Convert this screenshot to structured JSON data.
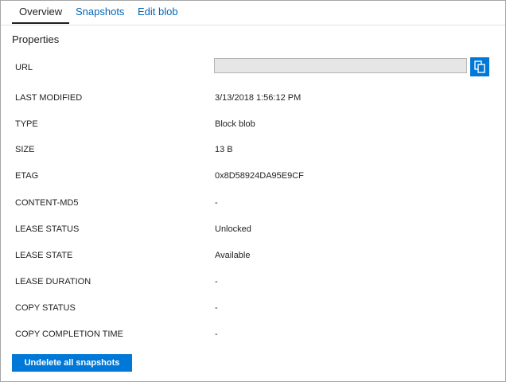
{
  "tabs": [
    {
      "label": "Overview",
      "active": true
    },
    {
      "label": "Snapshots",
      "active": false
    },
    {
      "label": "Edit blob",
      "active": false
    }
  ],
  "section_title": "Properties",
  "url": {
    "label": "URL",
    "value": ""
  },
  "properties": [
    {
      "label": "LAST MODIFIED",
      "value": "3/13/2018 1:56:12 PM"
    },
    {
      "label": "TYPE",
      "value": "Block blob"
    },
    {
      "label": "SIZE",
      "value": "13 B"
    },
    {
      "label": "ETAG",
      "value": "0x8D58924DA95E9CF"
    },
    {
      "label": "CONTENT-MD5",
      "value": "-"
    },
    {
      "label": "LEASE STATUS",
      "value": "Unlocked"
    },
    {
      "label": "LEASE STATE",
      "value": "Available"
    },
    {
      "label": "LEASE DURATION",
      "value": "-"
    },
    {
      "label": "COPY STATUS",
      "value": "-"
    },
    {
      "label": "COPY COMPLETION TIME",
      "value": "-"
    }
  ],
  "copy_icon": "copy-icon",
  "action_button_label": "Undelete all snapshots",
  "colors": {
    "accent": "#0078d7",
    "link": "#0066b8",
    "field_bg": "#e6e6e6"
  }
}
